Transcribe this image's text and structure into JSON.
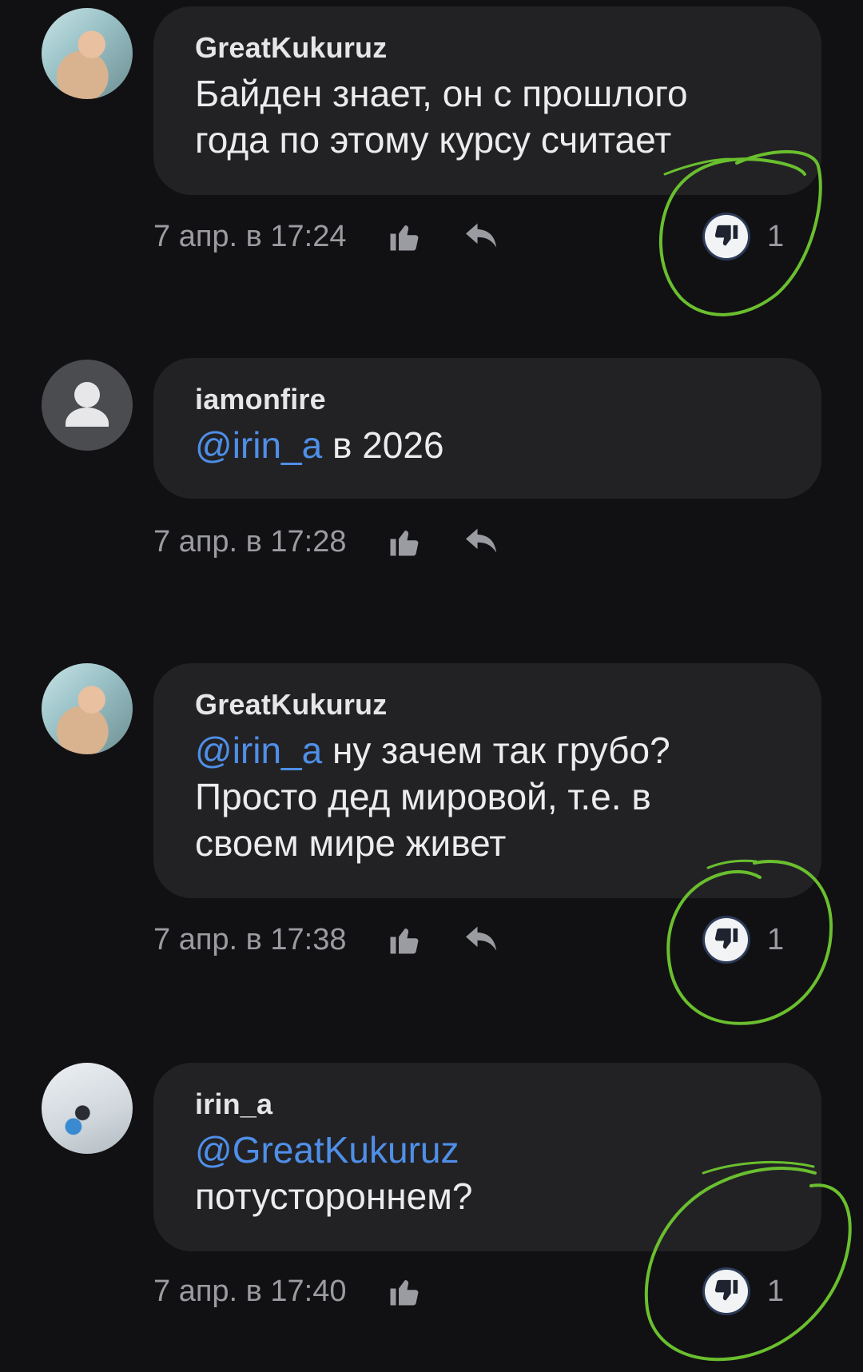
{
  "colors": {
    "background": "#111113",
    "bubble": "#222225",
    "mention": "#4f8fe8",
    "meta_text": "#9b9ca1",
    "annotation": "#6abf2e"
  },
  "comments": [
    {
      "author": "GreatKukuruz",
      "avatar": "photo-avatar",
      "lines": [
        "Байден знает, он с прошлого",
        "года по этому курсу считает"
      ],
      "time": "7 апр. в 17:24",
      "like_icon": "thumbs-up-icon",
      "reply_icon": "reply-icon",
      "dislike_icon": "thumbs-down-icon",
      "dislike_count": "1",
      "annotated": true
    },
    {
      "author": "iamonfire",
      "avatar": "placeholder-avatar",
      "mention": "@irin_a",
      "text_after_mention": " в 2026",
      "time": "7 апр. в 17:28",
      "like_icon": "thumbs-up-icon",
      "reply_icon": "reply-icon"
    },
    {
      "author": "GreatKukuruz",
      "avatar": "photo-avatar",
      "mention": "@irin_a",
      "text_after_mention": " ну зачем так грубо?",
      "lines": [
        "Просто дед мировой, т.е. в",
        "своем мире живет"
      ],
      "time": "7 апр. в 17:38",
      "like_icon": "thumbs-up-icon",
      "reply_icon": "reply-icon",
      "dislike_icon": "thumbs-down-icon",
      "dislike_count": "1",
      "annotated": true
    },
    {
      "author": "irin_a",
      "avatar": "photo-avatar",
      "mention": "@GreatKukuruz",
      "lines": [
        "потустороннем?"
      ],
      "time": "7 апр. в 17:40",
      "like_icon": "thumbs-up-icon",
      "dislike_icon": "thumbs-down-icon",
      "dislike_count": "1",
      "annotated": true
    }
  ]
}
